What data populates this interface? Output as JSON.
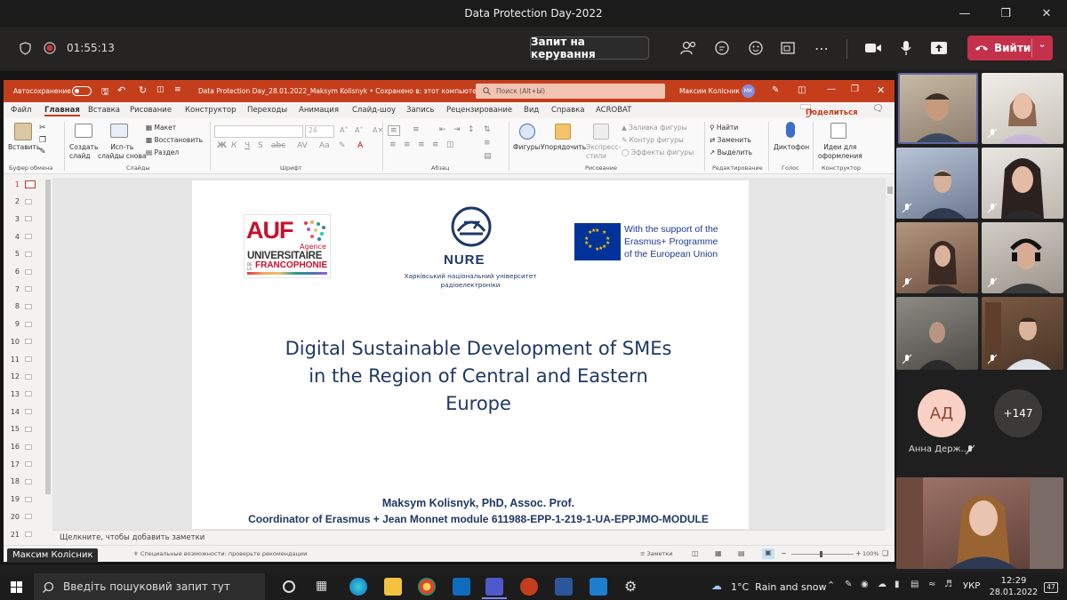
{
  "window": {
    "title": "Data Protection Day-2022"
  },
  "meeting": {
    "timer": "01:55:13",
    "request_control": "Запит на керування",
    "leave": "Вийти"
  },
  "ppt": {
    "autosave": "Автосохранение",
    "filename": "Data Protection Day_28.01.2022_Maksym Kolisnyk • Сохранено в: этот компьютер",
    "search": "Поиск (Alt+Ы)",
    "user": "Максим Колісник",
    "initials": "МК",
    "menu": [
      "Файл",
      "Главная",
      "Вставка",
      "Рисование",
      "Конструктор",
      "Переходы",
      "Анимация",
      "Слайд-шоу",
      "Запись",
      "Рецензирование",
      "Вид",
      "Справка",
      "ACROBAT"
    ],
    "share": "Поделиться",
    "ribbon": {
      "paste": "Вставить",
      "new_slide": "Создать\nслайд",
      "reuse": "Исп-ть\nслайды снова",
      "layout": "Макет",
      "reset": "Восстановить",
      "section": "Раздел",
      "shapes": "Фигуры",
      "arrange": "Упорядочить",
      "quick_styles": "Экспресс-\nстили",
      "fill": "Заливка фигуры",
      "outline": "Контур фигуры",
      "effects": "Эффекты фигуры",
      "find": "Найти",
      "replace": "Заменить",
      "select": "Выделить",
      "dictate": "Диктофон",
      "designer": "Идеи для\nоформления",
      "font_size": "24",
      "groups": [
        "Буфер обмена",
        "Слайды",
        "Шрифт",
        "Абзац",
        "Рисование",
        "Редактирование",
        "Голос",
        "Конструктор"
      ]
    },
    "slide_numbers": [
      "1",
      "2",
      "3",
      "4",
      "5",
      "6",
      "7",
      "8",
      "9",
      "10",
      "11",
      "12",
      "13",
      "14",
      "15",
      "16",
      "17",
      "18",
      "19",
      "20",
      "21"
    ],
    "slide": {
      "auf_main": "AUF",
      "auf_agence": "Agence",
      "auf_univ": "UNIVERSITAIRE",
      "auf_de_la": "DE LA",
      "auf_franco": "FRANCOPHONIE",
      "nure": "NURE",
      "nure_sub1": "Харківський національний університет",
      "nure_sub2": "радіоелектроніки",
      "eu1": "With the support of the",
      "eu2": "Erasmus+ Programme",
      "eu3": "of the European Union",
      "title1": "Digital Sustainable Development of SMEs",
      "title2": "in the Region of Central and Eastern",
      "title3": "Europe",
      "author": "Maksym Kolisnyk, PhD, Assoc. Prof.",
      "role": "Coordinator of Erasmus + Jean Monnet module 611988-EPP-1-219-1-UA-EPPJMO-MODULE"
    },
    "notes": "Щелкните, чтобы добавить заметки",
    "status_accessibility": "Специальные возможности: проверьте рекомендации",
    "status_notes": "Заметки",
    "zoom": "100%"
  },
  "presenter_label": "Максим Колісник",
  "participants": {
    "avatar_initials": "АД",
    "avatar_name": "Анна Держ...",
    "more": "+147"
  },
  "taskbar": {
    "search": "Введіть пошуковий запит тут",
    "weather": "1°C  Rain and snow",
    "lang": "УКР",
    "time": "12:29",
    "date": "28.01.2022",
    "notif": "47"
  }
}
